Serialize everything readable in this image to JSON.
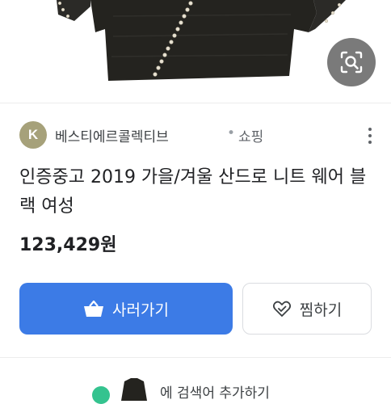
{
  "product": {
    "source_initial": "K",
    "source_name": "베스티에르콜렉티브",
    "source_separator": "•",
    "source_type": "쇼핑",
    "title": "인증중고 2019 가을/겨울 산드로 니트 웨어 블랙 여성",
    "price": "123,429원"
  },
  "actions": {
    "primary_label": "사러가기",
    "secondary_label": "찜하기"
  },
  "related": {
    "text": "에 검색어 추가하기"
  },
  "icons": {
    "lens": "image-search-icon",
    "more": "more-vertical-icon",
    "cart": "shopping-basket-icon",
    "wishlist": "heart-check-icon"
  },
  "colors": {
    "primary_button": "#3c7be6",
    "avatar": "#a6a17a",
    "lens_button": "#7a7a7a",
    "related_dot": "#34c38f"
  }
}
